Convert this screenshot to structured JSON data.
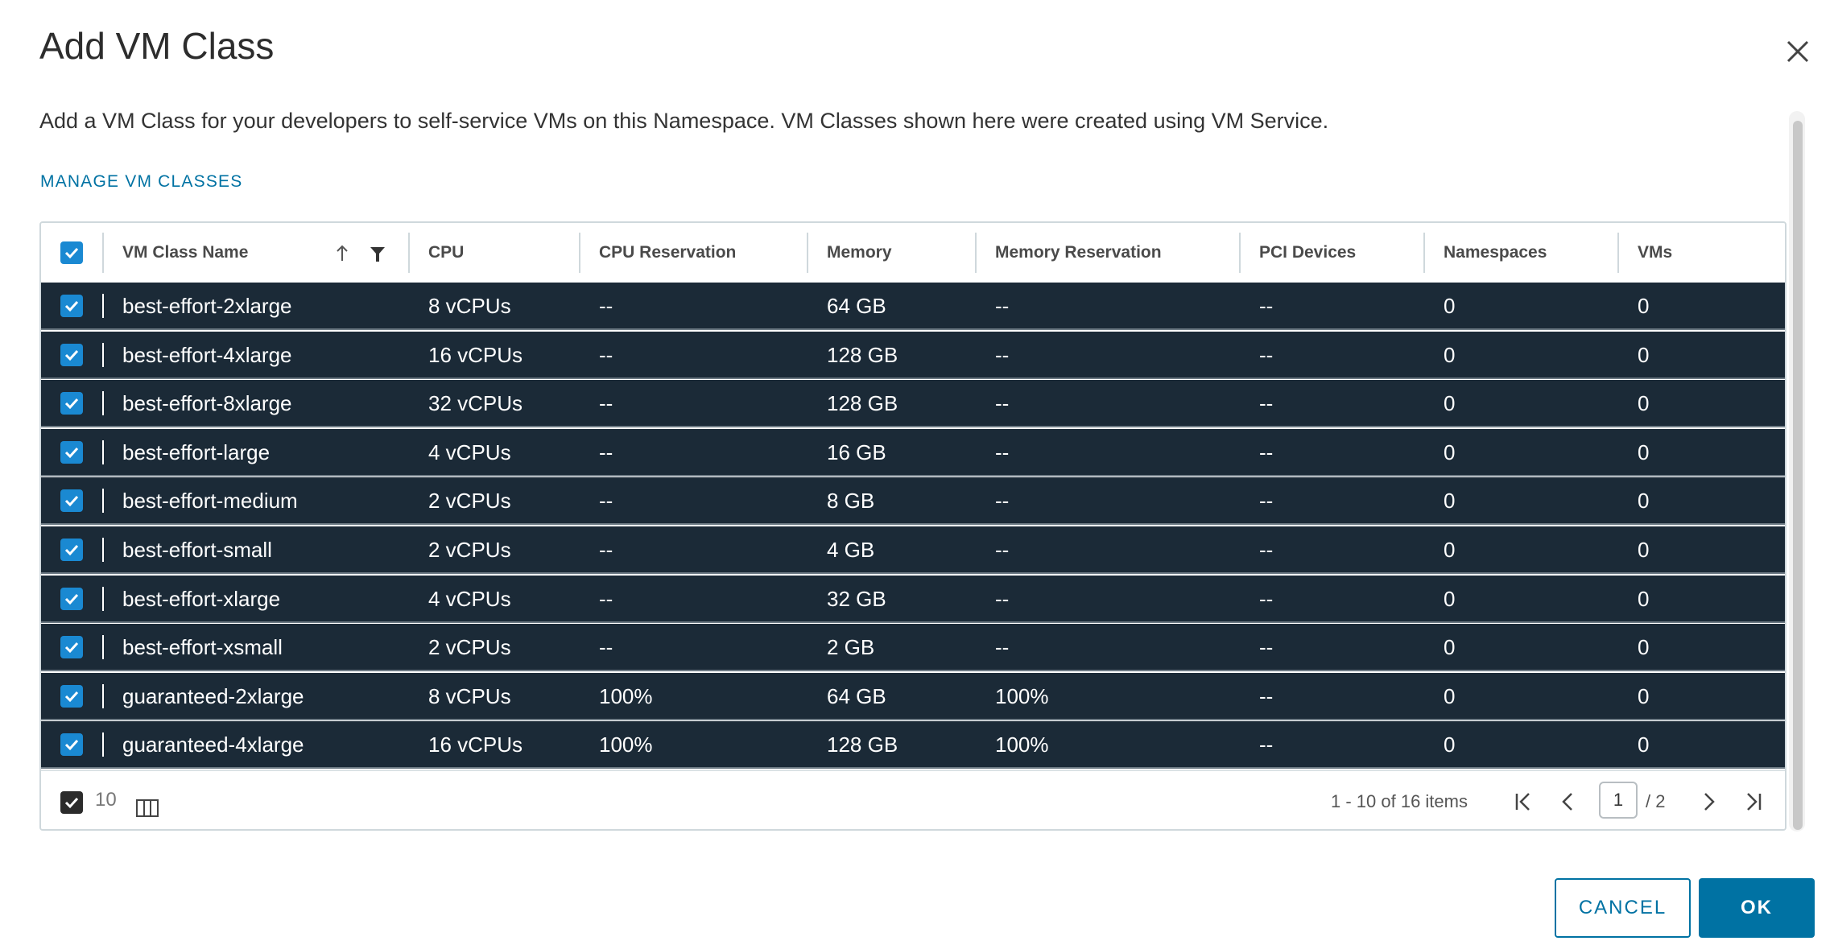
{
  "dialog": {
    "title": "Add VM Class",
    "description": "Add a VM Class for your developers to self-service VMs on this Namespace. VM Classes shown here were created using VM Service.",
    "manage_link": "MANAGE VM CLASSES",
    "close_icon": "close-icon"
  },
  "table": {
    "columns": [
      "VM Class Name",
      "CPU",
      "CPU Reservation",
      "Memory",
      "Memory Reservation",
      "PCI Devices",
      "Namespaces",
      "VMs"
    ],
    "sort_icon": "sort-ascending-icon",
    "filter_icon": "filter-icon",
    "rows": [
      {
        "name": "best-effort-2xlarge",
        "cpu": "8 vCPUs",
        "cpu_res": "--",
        "memory": "64 GB",
        "mem_res": "--",
        "pci": "--",
        "namespaces": "0",
        "vms": "0",
        "selected": true
      },
      {
        "name": "best-effort-4xlarge",
        "cpu": "16 vCPUs",
        "cpu_res": "--",
        "memory": "128 GB",
        "mem_res": "--",
        "pci": "--",
        "namespaces": "0",
        "vms": "0",
        "selected": true
      },
      {
        "name": "best-effort-8xlarge",
        "cpu": "32 vCPUs",
        "cpu_res": "--",
        "memory": "128 GB",
        "mem_res": "--",
        "pci": "--",
        "namespaces": "0",
        "vms": "0",
        "selected": true
      },
      {
        "name": "best-effort-large",
        "cpu": "4 vCPUs",
        "cpu_res": "--",
        "memory": "16 GB",
        "mem_res": "--",
        "pci": "--",
        "namespaces": "0",
        "vms": "0",
        "selected": true
      },
      {
        "name": "best-effort-medium",
        "cpu": "2 vCPUs",
        "cpu_res": "--",
        "memory": "8 GB",
        "mem_res": "--",
        "pci": "--",
        "namespaces": "0",
        "vms": "0",
        "selected": true
      },
      {
        "name": "best-effort-small",
        "cpu": "2 vCPUs",
        "cpu_res": "--",
        "memory": "4 GB",
        "mem_res": "--",
        "pci": "--",
        "namespaces": "0",
        "vms": "0",
        "selected": true
      },
      {
        "name": "best-effort-xlarge",
        "cpu": "4 vCPUs",
        "cpu_res": "--",
        "memory": "32 GB",
        "mem_res": "--",
        "pci": "--",
        "namespaces": "0",
        "vms": "0",
        "selected": true
      },
      {
        "name": "best-effort-xsmall",
        "cpu": "2 vCPUs",
        "cpu_res": "--",
        "memory": "2 GB",
        "mem_res": "--",
        "pci": "--",
        "namespaces": "0",
        "vms": "0",
        "selected": true
      },
      {
        "name": "guaranteed-2xlarge",
        "cpu": "8 vCPUs",
        "cpu_res": "100%",
        "memory": "64 GB",
        "mem_res": "100%",
        "pci": "--",
        "namespaces": "0",
        "vms": "0",
        "selected": true
      },
      {
        "name": "guaranteed-4xlarge",
        "cpu": "16 vCPUs",
        "cpu_res": "100%",
        "memory": "128 GB",
        "mem_res": "100%",
        "pci": "--",
        "namespaces": "0",
        "vms": "0",
        "selected": true
      }
    ]
  },
  "footer": {
    "selected_count": "10",
    "page_info": "1 - 10 of 16 items",
    "current_page": "1",
    "total_pages": "/ 2"
  },
  "buttons": {
    "cancel": "CANCEL",
    "ok": "OK"
  },
  "colors": {
    "accent": "#0072a3",
    "checkbox": "#1a89d2",
    "selected_row": "#1b2a37"
  }
}
